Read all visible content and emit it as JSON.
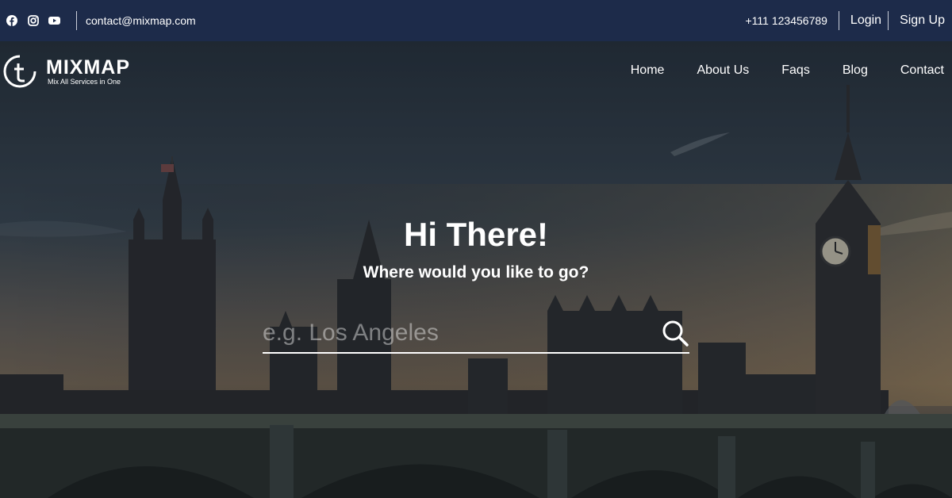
{
  "topbar": {
    "social": [
      {
        "name": "facebook-icon"
      },
      {
        "name": "instagram-icon"
      },
      {
        "name": "youtube-icon"
      }
    ],
    "email": "contact@mixmap.com",
    "phone": "+111 123456789",
    "login_label": "Login",
    "signup_label": "Sign Up"
  },
  "brand": {
    "name": "MIXMAP",
    "tagline": "Mix All Services in One"
  },
  "nav": {
    "items": [
      {
        "label": "Home"
      },
      {
        "label": "About Us"
      },
      {
        "label": "Faqs"
      },
      {
        "label": "Blog"
      },
      {
        "label": "Contact"
      }
    ]
  },
  "hero": {
    "title": "Hi There!",
    "subtitle": "Where would you like to go?",
    "search": {
      "value": "",
      "placeholder": "e.g. Los Angeles"
    }
  },
  "colors": {
    "topbar_bg": "#1d2b4a",
    "text": "#ffffff"
  }
}
